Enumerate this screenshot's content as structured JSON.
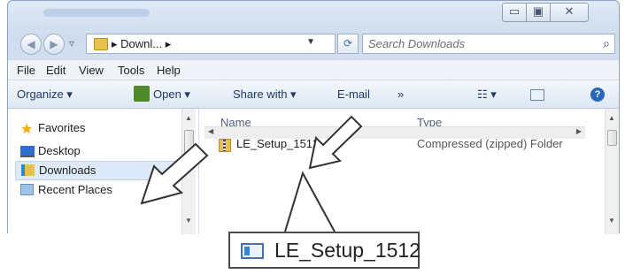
{
  "window": {
    "controls": {
      "minimize": "▭",
      "maximize": "▣",
      "close": "✕"
    }
  },
  "address": {
    "path_segment": "Downl...",
    "search_placeholder": "Search Downloads"
  },
  "menu": [
    "File",
    "Edit",
    "View",
    "Tools",
    "Help"
  ],
  "commands": {
    "organize": "Organize ▾",
    "open": "Open ▾",
    "share": "Share with ▾",
    "email": "E-mail",
    "more": "»",
    "views": "☷ ▾"
  },
  "nav": {
    "favorites": "Favorites",
    "items": [
      "Desktop",
      "Downloads",
      "Recent Places"
    ]
  },
  "files": {
    "columns": [
      "Name",
      "Type"
    ],
    "rows": [
      {
        "name": "LE_Setup_1512",
        "type": "Compressed (zipped) Folder"
      }
    ]
  },
  "callout": {
    "label": "LE_Setup_1512"
  }
}
